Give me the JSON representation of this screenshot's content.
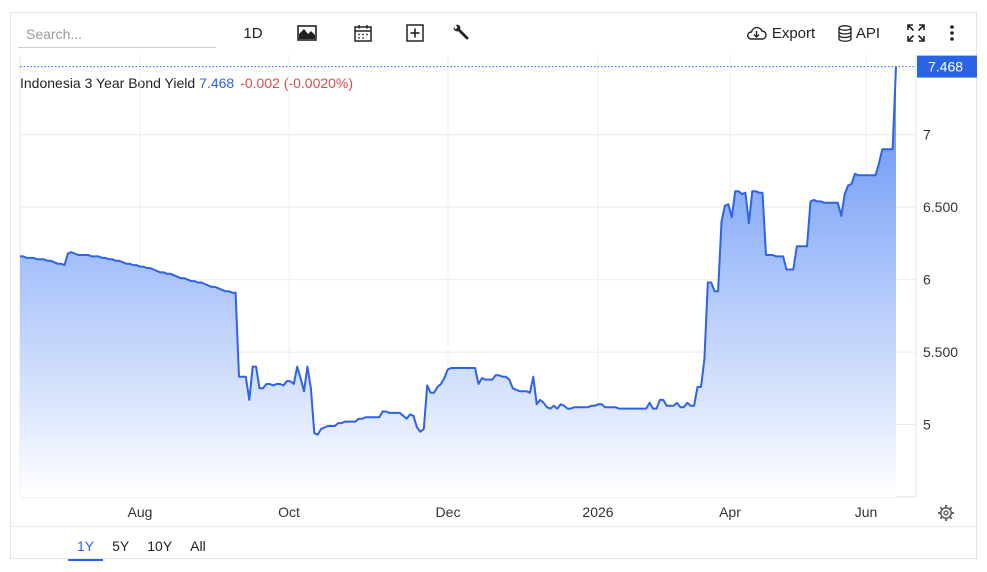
{
  "toolbar": {
    "search_placeholder": "Search...",
    "period_label": "1D",
    "chart_type_icon": "area-chart-icon",
    "calendar_icon": "calendar-icon",
    "compare_icon": "plus-box-icon",
    "settings_tool_icon": "wrench-icon",
    "export_label": "Export",
    "export_icon": "cloud-download-icon",
    "api_label": "API",
    "api_icon": "database-icon",
    "fullscreen_icon": "expand-icon",
    "more_icon": "vertical-dots-icon"
  },
  "header": {
    "name": "Indonesia 3 Year Bond Yield",
    "value": "7.468",
    "change": "-0.002 (-0.0020%)"
  },
  "range_tabs": [
    "1Y",
    "5Y",
    "10Y",
    "All"
  ],
  "active_range": "1Y",
  "colors": {
    "line": "#2f63e6",
    "fill_top": "#5b8cf5",
    "fill_bottom": "#ffffff",
    "price_tag": "#2a63e4",
    "change": "#e04a4a"
  },
  "chart_data": {
    "type": "area",
    "title": "Indonesia 3 Year Bond Yield",
    "x_ticks": [
      "Aug",
      "Oct",
      "Dec",
      "2026",
      "Apr",
      "Jun"
    ],
    "y_ticks": [
      "5",
      "5.500",
      "6",
      "6.500",
      "7"
    ],
    "ylim": [
      4.5,
      7.55
    ],
    "grid": true,
    "last_value_label": "7.468",
    "series": [
      {
        "values": [
          6.16,
          6.16,
          6.15,
          6.15,
          6.15,
          6.14,
          6.14,
          6.14,
          6.13,
          6.13,
          6.12,
          6.11,
          6.11,
          6.1,
          6.18,
          6.19,
          6.18,
          6.17,
          6.17,
          6.17,
          6.17,
          6.16,
          6.16,
          6.16,
          6.15,
          6.15,
          6.14,
          6.14,
          6.13,
          6.13,
          6.12,
          6.11,
          6.11,
          6.1,
          6.1,
          6.09,
          6.09,
          6.08,
          6.08,
          6.07,
          6.06,
          6.05,
          6.05,
          6.04,
          6.04,
          6.03,
          6.02,
          6.01,
          6.01,
          6.0,
          5.99,
          5.99,
          5.98,
          5.98,
          5.97,
          5.96,
          5.95,
          5.95,
          5.94,
          5.93,
          5.92,
          5.92,
          5.91,
          5.91,
          5.33,
          5.33,
          5.33,
          5.17,
          5.4,
          5.4,
          5.25,
          5.25,
          5.28,
          5.28,
          5.27,
          5.28,
          5.28,
          5.27,
          5.3,
          5.3,
          5.28,
          5.4,
          5.32,
          5.23,
          5.4,
          5.25,
          4.94,
          4.93,
          4.97,
          4.98,
          4.99,
          4.99,
          4.99,
          5.01,
          5.01,
          5.02,
          5.02,
          5.02,
          5.02,
          5.04,
          5.04,
          5.05,
          5.05,
          5.05,
          5.05,
          5.05,
          5.09,
          5.09,
          5.08,
          5.08,
          5.08,
          5.08,
          5.06,
          5.04,
          5.07,
          5.06,
          4.98,
          4.95,
          4.97,
          5.27,
          5.22,
          5.22,
          5.26,
          5.28,
          5.32,
          5.38,
          5.39,
          5.39,
          5.39,
          5.39,
          5.39,
          5.39,
          5.39,
          5.39,
          5.28,
          5.32,
          5.31,
          5.31,
          5.31,
          5.34,
          5.34,
          5.33,
          5.33,
          5.31,
          5.25,
          5.24,
          5.23,
          5.23,
          5.23,
          5.22,
          5.33,
          5.14,
          5.17,
          5.15,
          5.12,
          5.11,
          5.13,
          5.11,
          5.14,
          5.13,
          5.11,
          5.11,
          5.12,
          5.12,
          5.12,
          5.12,
          5.12,
          5.13,
          5.13,
          5.14,
          5.14,
          5.12,
          5.12,
          5.12,
          5.12,
          5.11,
          5.11,
          5.11,
          5.11,
          5.11,
          5.11,
          5.11,
          5.11,
          5.11,
          5.15,
          5.11,
          5.11,
          5.17,
          5.17,
          5.13,
          5.13,
          5.13,
          5.15,
          5.12,
          5.12,
          5.15,
          5.13,
          5.13,
          5.26,
          5.26,
          5.45,
          5.98,
          5.98,
          5.92,
          5.92,
          6.4,
          6.51,
          6.52,
          6.43,
          6.61,
          6.61,
          6.59,
          6.6,
          6.39,
          6.61,
          6.61,
          6.6,
          6.6,
          6.17,
          6.17,
          6.17,
          6.16,
          6.16,
          6.16,
          6.07,
          6.07,
          6.07,
          6.23,
          6.23,
          6.23,
          6.23,
          6.54,
          6.55,
          6.54,
          6.54,
          6.53,
          6.53,
          6.53,
          6.53,
          6.53,
          6.44,
          6.59,
          6.65,
          6.66,
          6.73,
          6.72,
          6.72,
          6.72,
          6.72,
          6.72,
          6.72,
          6.8,
          6.9,
          6.9,
          6.9,
          6.9,
          7.47
        ]
      }
    ]
  }
}
